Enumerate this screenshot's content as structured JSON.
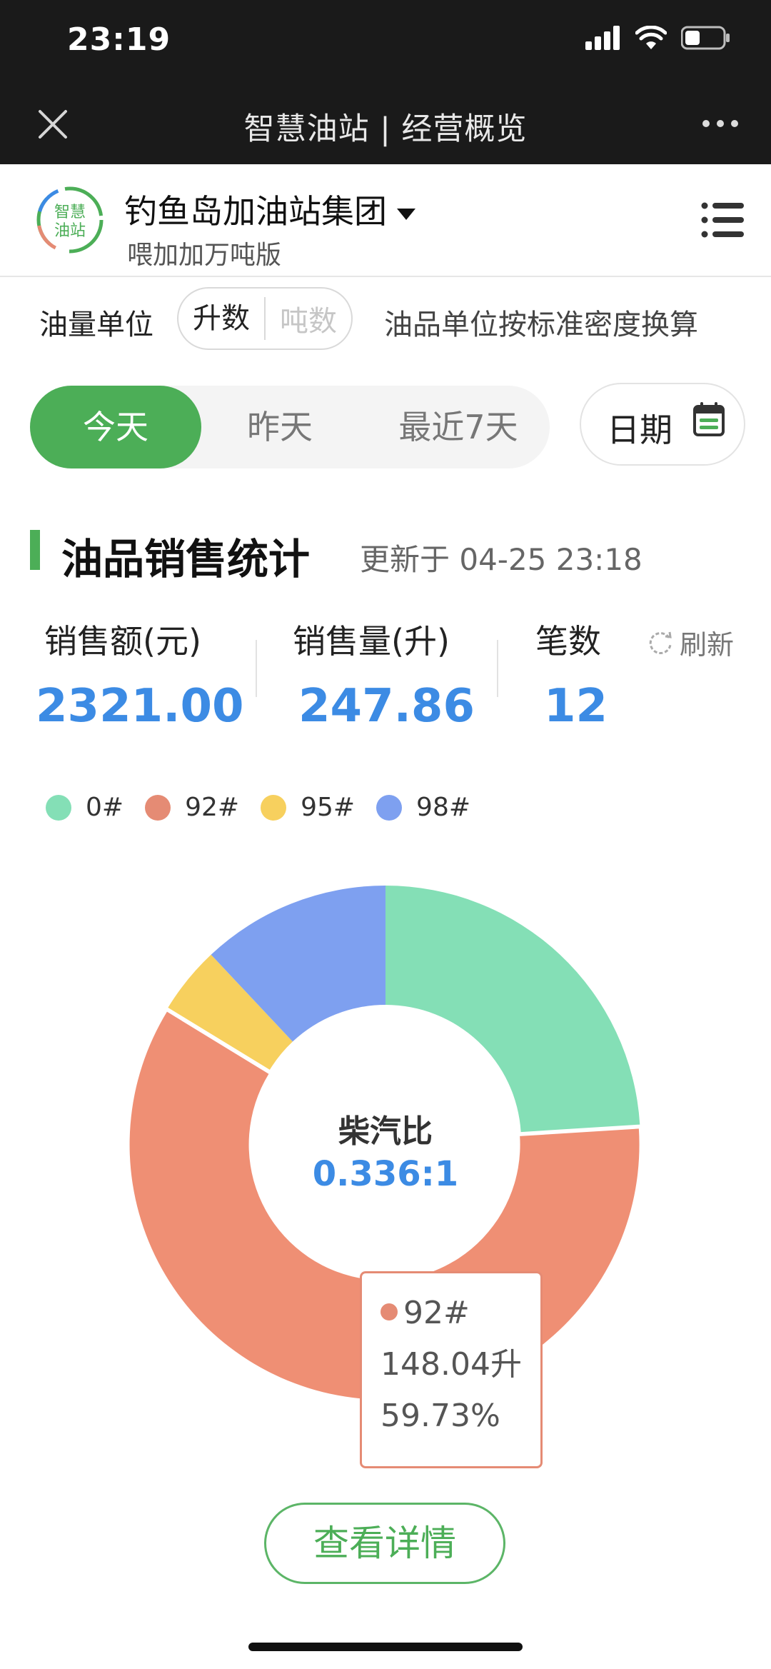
{
  "status_bar": {
    "time": "23:19"
  },
  "nav": {
    "title": "智慧油站 | 经营概览"
  },
  "org": {
    "logo_text": "智慧油站",
    "name": "钓鱼岛加油站集团",
    "subtitle": "喂加加万吨版"
  },
  "unit": {
    "label": "油量单位",
    "options": [
      "升数",
      "吨数"
    ],
    "selected": "升数",
    "note": "油品单位按标准密度换算"
  },
  "date_tabs": {
    "items": [
      "今天",
      "昨天",
      "最近7天"
    ],
    "active": "今天",
    "date_button": "日期"
  },
  "section": {
    "title": "油品销售统计",
    "updated": "更新于 04-25 23:18"
  },
  "stats": {
    "amount_label": "销售额(元)",
    "amount_value": "2321.00",
    "volume_label": "销售量(升)",
    "volume_value": "247.86",
    "count_label": "笔数",
    "count_value": "12",
    "refresh_label": "刷新"
  },
  "colors": {
    "green": "#4cae57",
    "blue_value": "#3c8be4"
  },
  "chart_data": {
    "type": "pie",
    "donut": true,
    "categories": [
      "0#",
      "92#",
      "95#",
      "98#"
    ],
    "values": [
      24,
      59.73,
      4.27,
      12
    ],
    "colors": [
      "#84dfb6",
      "#ef8f74",
      "#f7d05e",
      "#7ea0f0"
    ],
    "legend": [
      "0#",
      "92#",
      "95#",
      "98#"
    ],
    "legend_position": "top-left",
    "center_title": "柴汽比",
    "center_value": "0.336:1",
    "tooltip": {
      "series": "92#",
      "volume": "148.04升",
      "percent": "59.73%"
    }
  },
  "detail_button": "查看详情"
}
